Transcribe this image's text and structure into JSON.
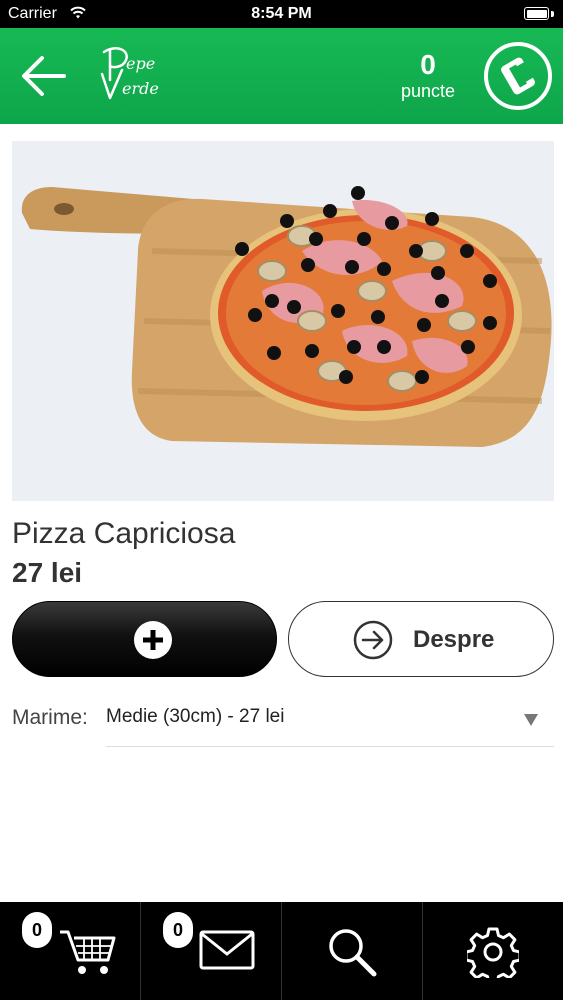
{
  "status_bar": {
    "carrier": "Carrier",
    "time": "8:54 PM"
  },
  "header": {
    "logo_text_top": "Pepe",
    "logo_text_bottom": "Verde",
    "points_value": "0",
    "points_label": "puncte"
  },
  "product": {
    "name": "Pizza Capriciosa",
    "price": "27 lei",
    "add_icon": "plus-circle-icon",
    "about_label": "Despre",
    "size_label": "Marime:",
    "size_value": "Medie (30cm) - 27 lei"
  },
  "tab_bar": {
    "cart_badge": "0",
    "messages_badge": "0",
    "tabs": [
      "cart-icon",
      "mail-icon",
      "search-icon",
      "gear-icon"
    ]
  },
  "colors": {
    "brand_green": "#12b04f",
    "button_dark": "#000000"
  }
}
